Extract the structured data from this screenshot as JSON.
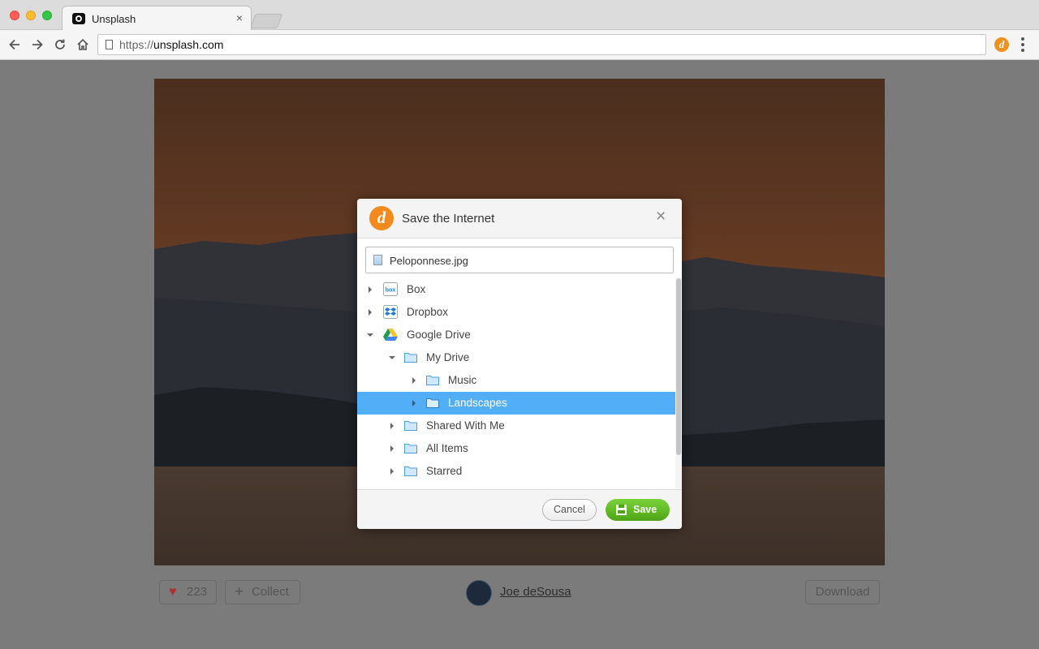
{
  "browser": {
    "tab_title": "Unsplash",
    "tab_close": "×",
    "url_scheme": "https://",
    "url_host": "unsplash.com"
  },
  "page": {
    "likes_count": "223",
    "collect_label": "Collect",
    "collect_icon": "+",
    "heart_icon": "♥",
    "author": "Joe deSousa",
    "download_label": "Download"
  },
  "dialog": {
    "title": "Save the Internet",
    "logo_letter": "d",
    "close_icon": "×",
    "filename": "Peloponnese.jpg",
    "tree": [
      {
        "label": "Box",
        "icon": "box-icon",
        "expanded": false,
        "selected": false
      },
      {
        "label": "Dropbox",
        "icon": "dropbox-icon",
        "expanded": false,
        "selected": false
      },
      {
        "label": "Google Drive",
        "icon": "google-drive-icon",
        "expanded": true,
        "selected": false
      },
      {
        "label": "My Drive",
        "icon": "folder-icon",
        "expanded": true,
        "selected": false
      },
      {
        "label": "Music",
        "icon": "folder-icon",
        "expanded": false,
        "selected": false
      },
      {
        "label": "Landscapes",
        "icon": "folder-icon",
        "expanded": false,
        "selected": true
      },
      {
        "label": "Shared With Me",
        "icon": "folder-icon",
        "expanded": false,
        "selected": false
      },
      {
        "label": "All Items",
        "icon": "folder-icon",
        "expanded": false,
        "selected": false
      },
      {
        "label": "Starred",
        "icon": "folder-icon",
        "expanded": false,
        "selected": false
      }
    ],
    "cancel_label": "Cancel",
    "save_label": "Save"
  },
  "colors": {
    "selection": "#52aef7",
    "save_green": "#5cb81e",
    "brand_orange": "#f38a1d"
  }
}
